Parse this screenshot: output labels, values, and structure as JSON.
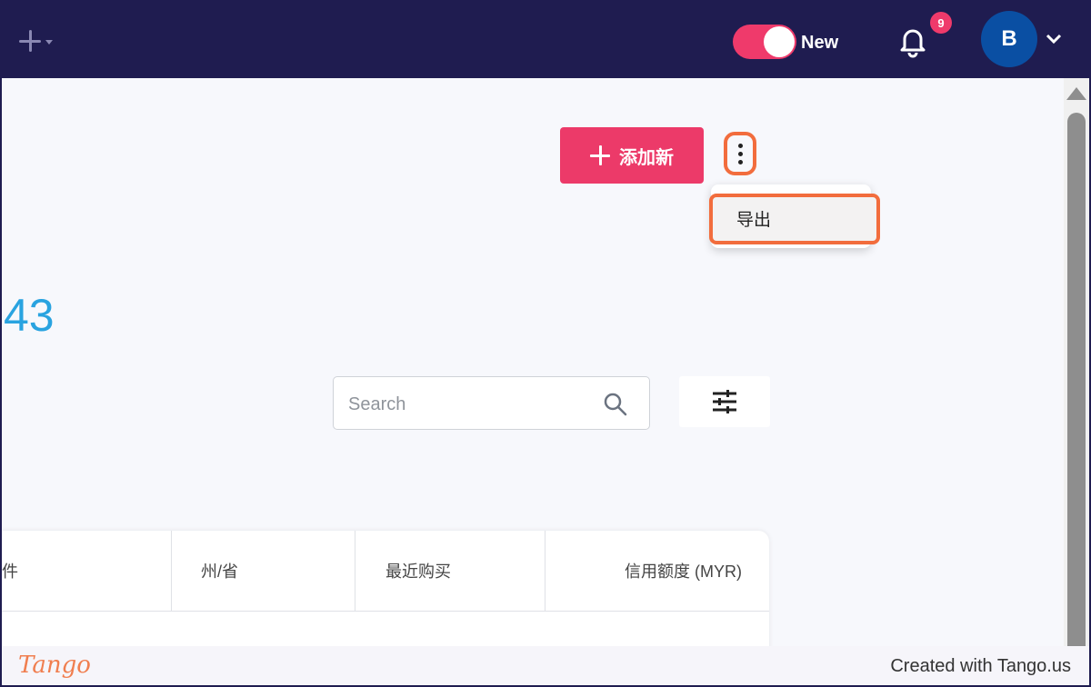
{
  "topbar": {
    "toggle_label": "New",
    "notification_count": "9",
    "avatar_initial": "B",
    "colors": {
      "bar": "#1f1c50",
      "accent": "#ef3a6b",
      "avatar": "#0a4fa3"
    }
  },
  "toolbar": {
    "add_new_label": "添加新",
    "more_menu": {
      "items": [
        "导出"
      ]
    }
  },
  "summary": {
    "count_partial": "43"
  },
  "search": {
    "placeholder": "Search",
    "value": ""
  },
  "table": {
    "headers": [
      "件",
      "州/省",
      "最近购买",
      "信用额度 (MYR)"
    ]
  },
  "footer": {
    "logo": "Tango",
    "credit": "Created with Tango.us"
  },
  "highlight_color": "#f26d3d"
}
